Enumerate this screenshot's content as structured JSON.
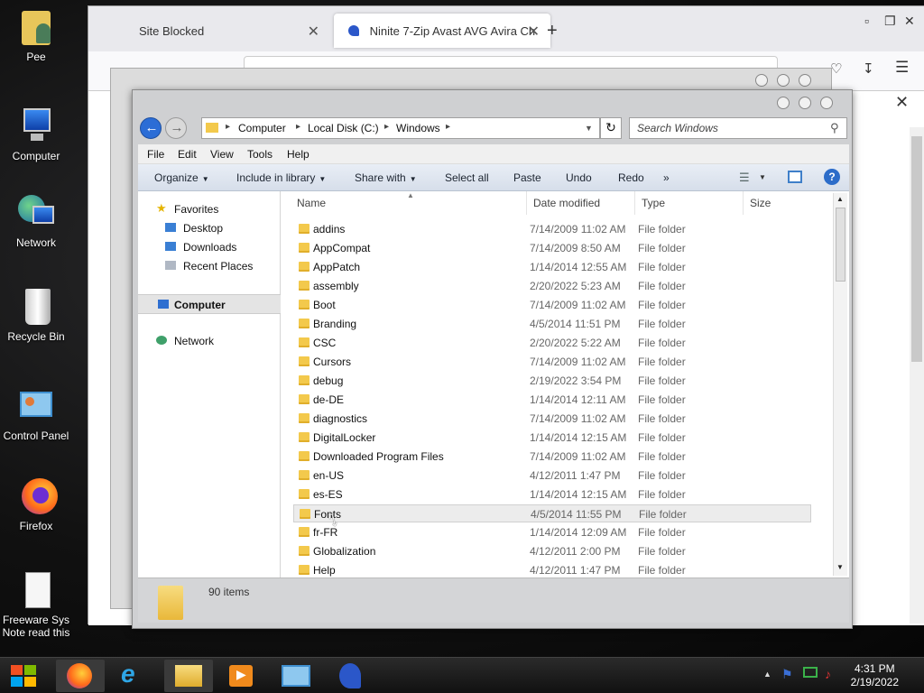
{
  "desktop": {
    "icons": [
      {
        "label": "Pee"
      },
      {
        "label": "Computer"
      },
      {
        "label": "Network"
      },
      {
        "label": "Recycle Bin"
      },
      {
        "label": "Control Panel"
      },
      {
        "label": "Firefox"
      },
      {
        "label": "Freeware Sys Note read this"
      }
    ]
  },
  "browser": {
    "tabs": [
      {
        "label": "Site Blocked"
      },
      {
        "label": "Ninite 7-Zip Avast AVG Avira Ch"
      }
    ],
    "new_tab": "+",
    "close_glyph": "✕"
  },
  "explorer": {
    "breadcrumb": [
      "Computer",
      "Local Disk (C:)",
      "Windows"
    ],
    "search_placeholder": "Search Windows",
    "menu": [
      "File",
      "Edit",
      "View",
      "Tools",
      "Help"
    ],
    "commands": {
      "organize": "Organize",
      "include": "Include in library",
      "share": "Share with",
      "select_all": "Select all",
      "paste": "Paste",
      "undo": "Undo",
      "redo": "Redo",
      "more": "»"
    },
    "nav": {
      "favorites": "Favorites",
      "desktop": "Desktop",
      "downloads": "Downloads",
      "recent": "Recent Places",
      "computer": "Computer",
      "network": "Network"
    },
    "columns": {
      "name": "Name",
      "date": "Date modified",
      "type": "Type",
      "size": "Size"
    },
    "files": [
      {
        "name": "addins",
        "date": "7/14/2009 11:02 AM",
        "type": "File folder"
      },
      {
        "name": "AppCompat",
        "date": "7/14/2009 8:50 AM",
        "type": "File folder"
      },
      {
        "name": "AppPatch",
        "date": "1/14/2014 12:55 AM",
        "type": "File folder"
      },
      {
        "name": "assembly",
        "date": "2/20/2022 5:23 AM",
        "type": "File folder"
      },
      {
        "name": "Boot",
        "date": "7/14/2009 11:02 AM",
        "type": "File folder"
      },
      {
        "name": "Branding",
        "date": "4/5/2014 11:51 PM",
        "type": "File folder"
      },
      {
        "name": "CSC",
        "date": "2/20/2022 5:22 AM",
        "type": "File folder"
      },
      {
        "name": "Cursors",
        "date": "7/14/2009 11:02 AM",
        "type": "File folder"
      },
      {
        "name": "debug",
        "date": "2/19/2022 3:54 PM",
        "type": "File folder"
      },
      {
        "name": "de-DE",
        "date": "1/14/2014 12:11 AM",
        "type": "File folder"
      },
      {
        "name": "diagnostics",
        "date": "7/14/2009 11:02 AM",
        "type": "File folder"
      },
      {
        "name": "DigitalLocker",
        "date": "1/14/2014 12:15 AM",
        "type": "File folder"
      },
      {
        "name": "Downloaded Program Files",
        "date": "7/14/2009 11:02 AM",
        "type": "File folder"
      },
      {
        "name": "en-US",
        "date": "4/12/2011 1:47 PM",
        "type": "File folder"
      },
      {
        "name": "es-ES",
        "date": "1/14/2014 12:15 AM",
        "type": "File folder"
      },
      {
        "name": "Fonts",
        "date": "4/5/2014 11:55 PM",
        "type": "File folder"
      },
      {
        "name": "fr-FR",
        "date": "1/14/2014 12:09 AM",
        "type": "File folder"
      },
      {
        "name": "Globalization",
        "date": "4/12/2011 2:00 PM",
        "type": "File folder"
      },
      {
        "name": "Help",
        "date": "4/12/2011 1:47 PM",
        "type": "File folder"
      }
    ],
    "status": "90 items"
  },
  "taskbar": {
    "time": "4:31 PM",
    "date": "2/19/2022"
  }
}
